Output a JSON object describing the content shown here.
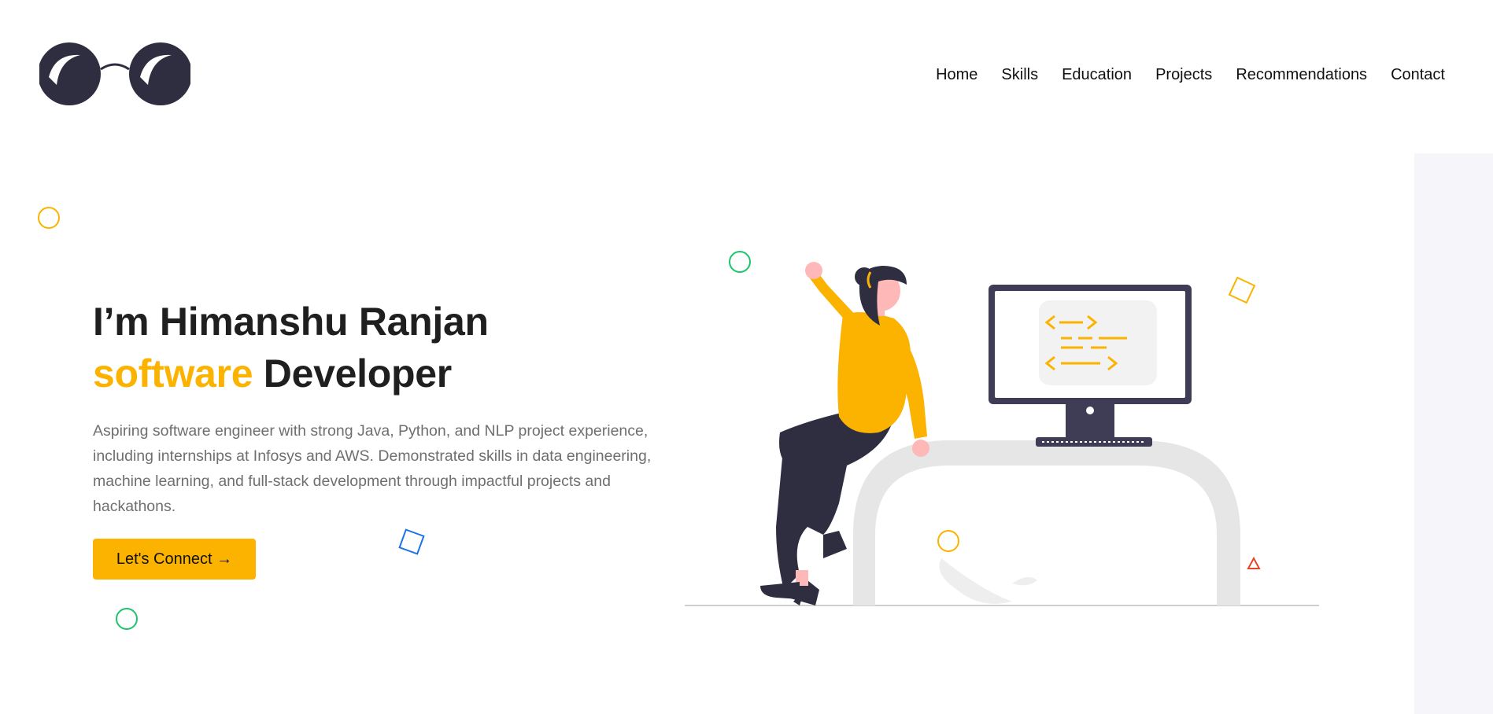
{
  "nav": {
    "items": [
      {
        "label": "Home"
      },
      {
        "label": "Skills"
      },
      {
        "label": "Education"
      },
      {
        "label": "Projects"
      },
      {
        "label": "Recommendations"
      },
      {
        "label": "Contact"
      }
    ]
  },
  "hero": {
    "greeting": "I’m Himanshu Ranjan",
    "role_accent": "software",
    "role_rest": " Developer",
    "description": "Aspiring software engineer with strong Java, Python, and NLP project experience, including internships at Infosys and AWS. Demonstrated skills in data engineering, machine learning, and full-stack development through impactful projects and hackathons.",
    "cta_label": "Let's Connect →"
  },
  "colors": {
    "accent": "#fbb300",
    "dark": "#2f2e41",
    "green": "#1dc46a",
    "blue": "#1a73e8",
    "red": "#e8442a"
  },
  "icons": {
    "logo": "glasses-icon",
    "illustration": "developer-at-desk-illustration"
  }
}
